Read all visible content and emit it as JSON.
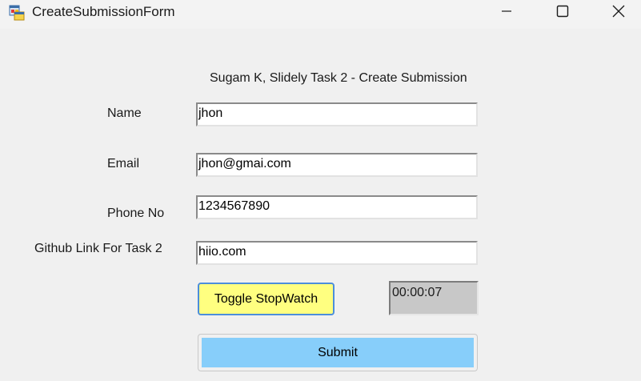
{
  "window": {
    "title": "CreateSubmissionForm"
  },
  "form": {
    "heading": "Sugam K, Slidely Task 2 - Create Submission",
    "name_label": "Name",
    "name_value": "jhon",
    "email_label": "Email",
    "email_value": "jhon@gmai.com",
    "phone_label": "Phone No",
    "phone_value": "1234567890",
    "github_label": "Github Link For Task 2",
    "github_value": "hiio.com",
    "toggle_label": "Toggle StopWatch",
    "stopwatch_value": "00:00:07",
    "submit_label": "Submit"
  },
  "colors": {
    "toggle_bg": "#ffff80",
    "toggle_border": "#4c8edb",
    "submit_bg": "#87cefa",
    "stopwatch_bg": "#c8c8c8"
  },
  "icons": {
    "app": "form-app-icon",
    "minimize": "minimize-icon",
    "maximize": "maximize-icon",
    "close": "close-icon"
  }
}
